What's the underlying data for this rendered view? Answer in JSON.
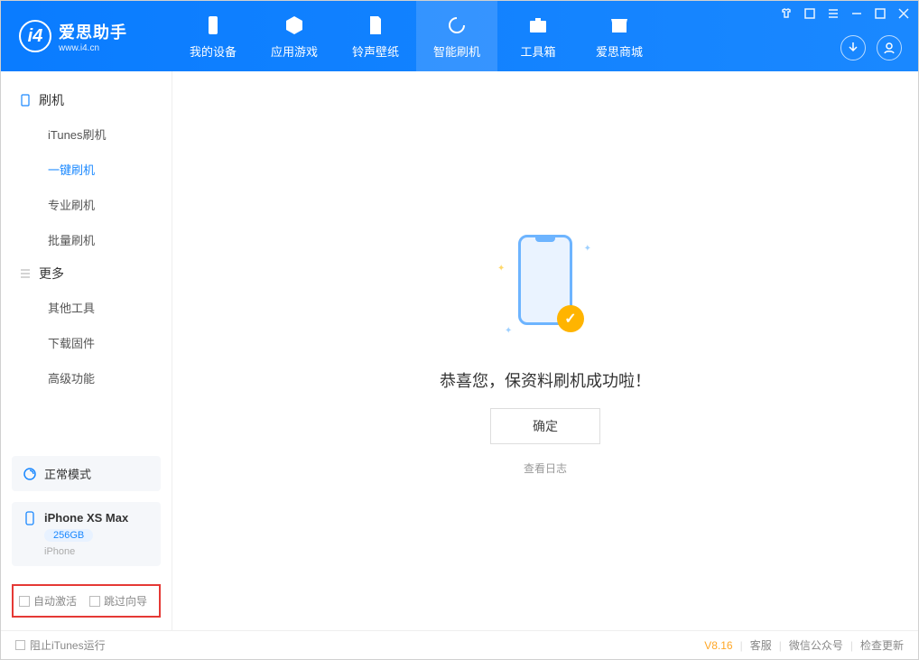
{
  "app": {
    "name_cn": "爱思助手",
    "name_en": "www.i4.cn"
  },
  "tabs": {
    "device": "我的设备",
    "apps": "应用游戏",
    "ring": "铃声壁纸",
    "flash": "智能刷机",
    "toolbox": "工具箱",
    "store": "爱思商城"
  },
  "sidebar": {
    "section_flash": "刷机",
    "items_flash": {
      "itunes": "iTunes刷机",
      "oneclick": "一键刷机",
      "pro": "专业刷机",
      "batch": "批量刷机"
    },
    "section_more": "更多",
    "items_more": {
      "other": "其他工具",
      "firmware": "下载固件",
      "advanced": "高级功能"
    }
  },
  "device_panel": {
    "mode": "正常模式"
  },
  "device": {
    "name": "iPhone XS Max",
    "capacity": "256GB",
    "sub": "iPhone"
  },
  "checks": {
    "auto_activate": "自动激活",
    "skip_guide": "跳过向导"
  },
  "main": {
    "success": "恭喜您，保资料刷机成功啦！",
    "ok": "确定",
    "view_log": "查看日志"
  },
  "footer": {
    "block_itunes": "阻止iTunes运行",
    "version": "V8.16",
    "support": "客服",
    "wechat": "微信公众号",
    "update": "检查更新"
  }
}
